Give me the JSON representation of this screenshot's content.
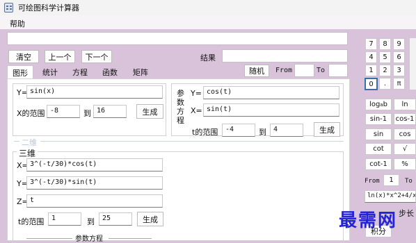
{
  "window": {
    "title": "可绘图科学计算器"
  },
  "menu": {
    "help": "帮助"
  },
  "toolbar": {
    "clear": "清空",
    "prev": "上一个",
    "next": "下一个",
    "result_label": "结果",
    "expression": "",
    "result": ""
  },
  "tabs": [
    "图形",
    "统计",
    "方程",
    "函数",
    "矩阵"
  ],
  "top_right": {
    "mode": "随机",
    "from": "From",
    "to": "To"
  },
  "plot2d": {
    "y_label": "Y=",
    "y_expr": "sin(x)",
    "x_range_label": "X的范围",
    "x_from": "-8",
    "to": "到",
    "x_to": "16",
    "generate": "生成"
  },
  "param2d": {
    "side_label": [
      "参",
      "数",
      "方",
      "程"
    ],
    "y_label": "Y=",
    "y_expr": "cos(t)",
    "x_label": "X=",
    "x_expr": "sin(t)",
    "t_range_label": "t的范围",
    "t_from": "-4",
    "to": "到",
    "t_to": "4",
    "generate": "生成"
  },
  "section_2d_label": "二维",
  "plot3d": {
    "title": "三维",
    "x_label": "X=",
    "x_expr": "3^(-t/30)*cos(t)",
    "y_label": "Y=",
    "y_expr": "3^(-t/30)*sin(t)",
    "z_label": "Z=",
    "z_expr": "t",
    "t_range_label": "t的范围",
    "t_from": "1",
    "to": "到",
    "t_to": "25",
    "generate": "生成",
    "footer": "参数方程"
  },
  "keypad": {
    "digits": [
      "7",
      "8",
      "9",
      "4",
      "5",
      "6",
      "1",
      "2",
      "3",
      "0",
      ".",
      "π"
    ],
    "functions": [
      "log",
      "ln",
      "sin-1",
      "cos-1",
      "sin",
      "cos",
      "cot",
      "√",
      "cot-1",
      "%"
    ],
    "log_subscript": "a",
    "log_suffix": "b",
    "from": "From",
    "from_value": "1",
    "to": "To",
    "integrand": "ln(x)*x^2+4/x",
    "step_label": "步长",
    "integral": "积分"
  },
  "watermark": "最需网"
}
